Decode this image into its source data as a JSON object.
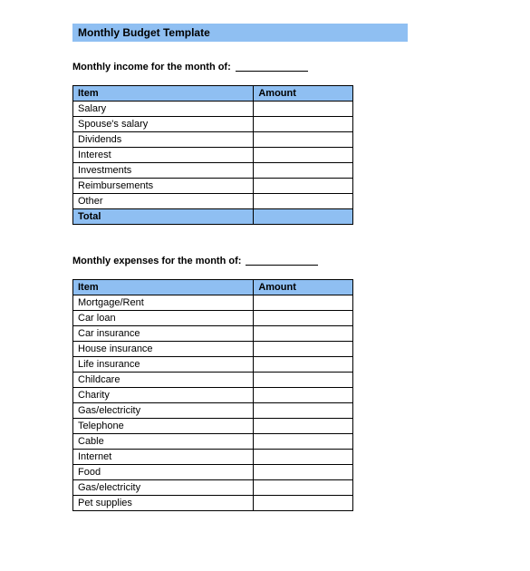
{
  "title": "Monthly Budget Template",
  "income": {
    "heading": "Monthly income for the month of:",
    "col_item": "Item",
    "col_amount": "Amount",
    "rows": [
      {
        "item": "Salary",
        "amount": ""
      },
      {
        "item": "Spouse's salary",
        "amount": ""
      },
      {
        "item": "Dividends",
        "amount": ""
      },
      {
        "item": "Interest",
        "amount": ""
      },
      {
        "item": "Investments",
        "amount": ""
      },
      {
        "item": "Reimbursements",
        "amount": ""
      },
      {
        "item": "Other",
        "amount": ""
      }
    ],
    "total_label": "Total",
    "total_amount": ""
  },
  "expenses": {
    "heading": "Monthly expenses for the month of:",
    "col_item": "Item",
    "col_amount": "Amount",
    "rows": [
      {
        "item": "Mortgage/Rent",
        "amount": ""
      },
      {
        "item": "Car loan",
        "amount": ""
      },
      {
        "item": "Car insurance",
        "amount": ""
      },
      {
        "item": "House insurance",
        "amount": ""
      },
      {
        "item": "Life insurance",
        "amount": ""
      },
      {
        "item": "Childcare",
        "amount": ""
      },
      {
        "item": "Charity",
        "amount": ""
      },
      {
        "item": "Gas/electricity",
        "amount": ""
      },
      {
        "item": "Telephone",
        "amount": ""
      },
      {
        "item": "Cable",
        "amount": ""
      },
      {
        "item": "Internet",
        "amount": ""
      },
      {
        "item": "Food",
        "amount": ""
      },
      {
        "item": "Gas/electricity",
        "amount": ""
      },
      {
        "item": "Pet supplies",
        "amount": ""
      }
    ]
  }
}
